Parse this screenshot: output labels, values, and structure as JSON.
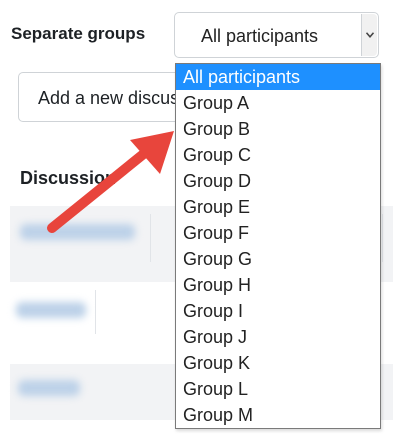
{
  "groups": {
    "label": "Separate groups",
    "selected": "All participants",
    "options": [
      "All participants",
      "Group A",
      "Group B",
      "Group C",
      "Group D",
      "Group E",
      "Group F",
      "Group G",
      "Group H",
      "Group I",
      "Group J",
      "Group K",
      "Group L",
      "Group M"
    ]
  },
  "actions": {
    "add_discussion": "Add a new discussion topic"
  },
  "table": {
    "heading": "Discussion"
  },
  "colors": {
    "highlight": "#1e90ff",
    "arrow": "#e8453c"
  }
}
